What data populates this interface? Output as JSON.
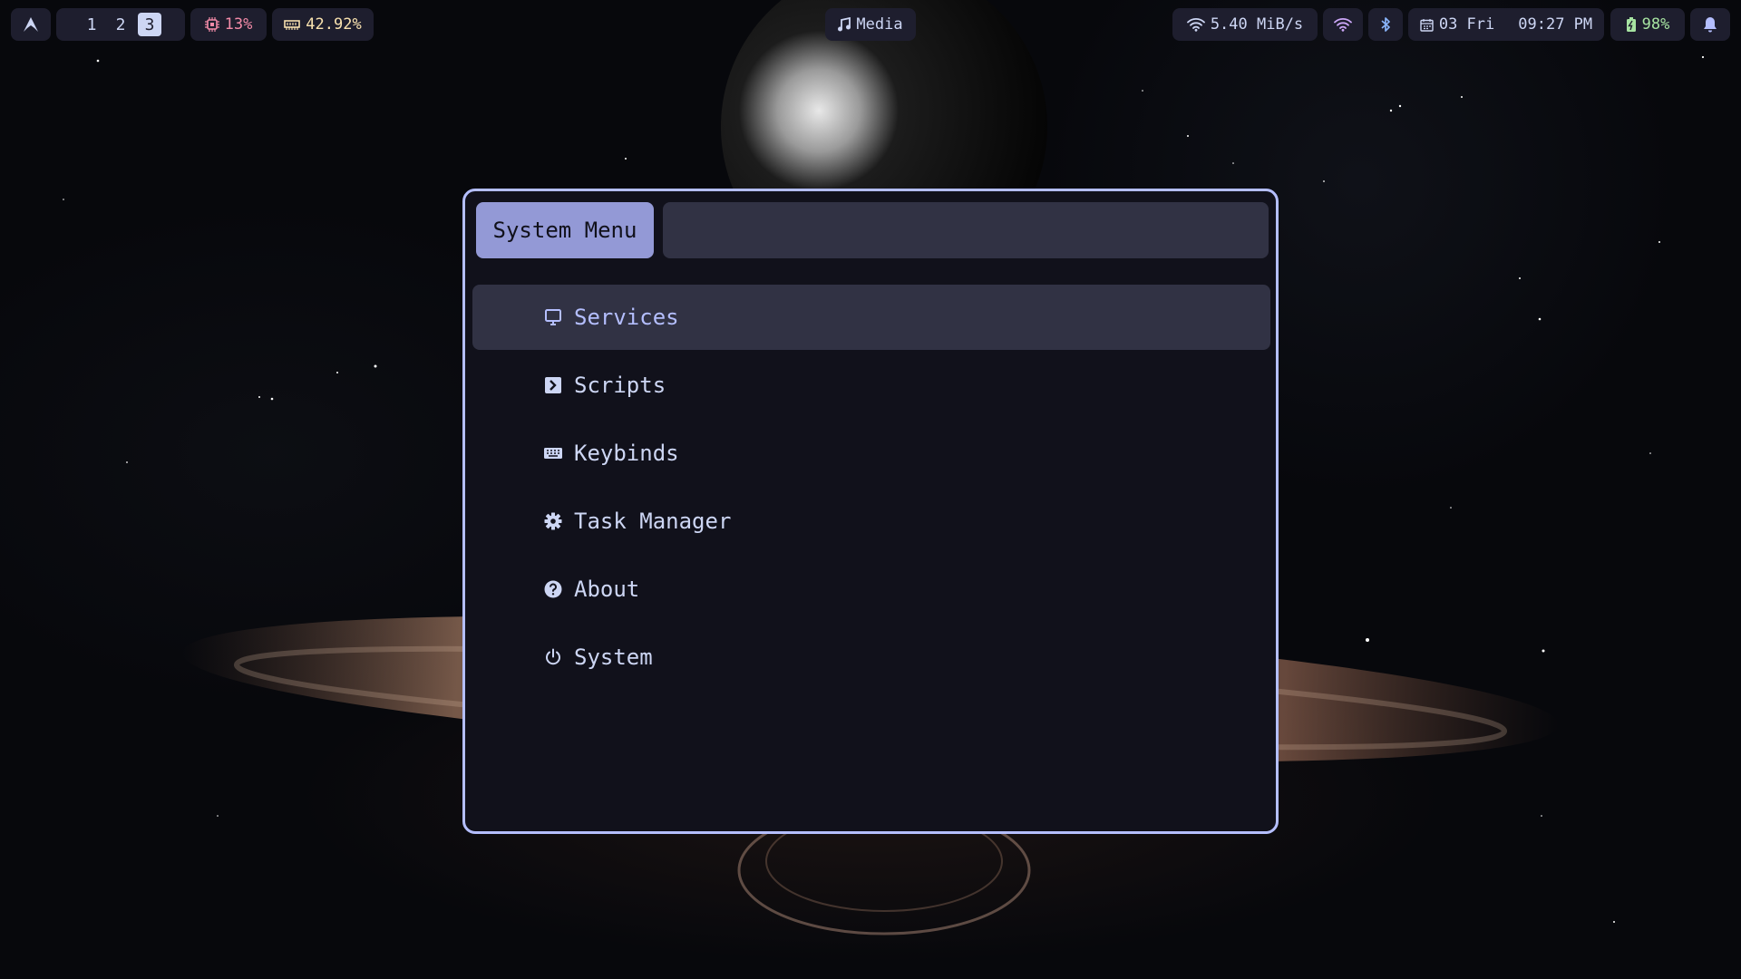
{
  "bar": {
    "workspaces": [
      "1",
      "2",
      "3"
    ],
    "active_workspace": "3",
    "cpu": "13%",
    "memory": "42.92%",
    "media": "Media",
    "network_speed": "5.40 MiB/s",
    "date": "03 Fri",
    "time": "09:27 PM",
    "battery": "98%",
    "colors": {
      "cpu": "#f38ba8",
      "memory": "#f9e2af",
      "battery": "#a6e3a1",
      "notification": "#b4befe"
    }
  },
  "menu": {
    "prompt": "System Menu",
    "search_value": "",
    "items": [
      {
        "label": "Services",
        "icon": "monitor-icon",
        "selected": true
      },
      {
        "label": "Scripts",
        "icon": "terminal-icon",
        "selected": false
      },
      {
        "label": "Keybinds",
        "icon": "keyboard-icon",
        "selected": false
      },
      {
        "label": "Task Manager",
        "icon": "gear-icon",
        "selected": false
      },
      {
        "label": "About",
        "icon": "question-icon",
        "selected": false
      },
      {
        "label": "System",
        "icon": "power-icon",
        "selected": false
      }
    ],
    "colors": {
      "border": "#b4befe",
      "prompt_bg": "#9399d6",
      "selected_bg": "#313244"
    }
  }
}
